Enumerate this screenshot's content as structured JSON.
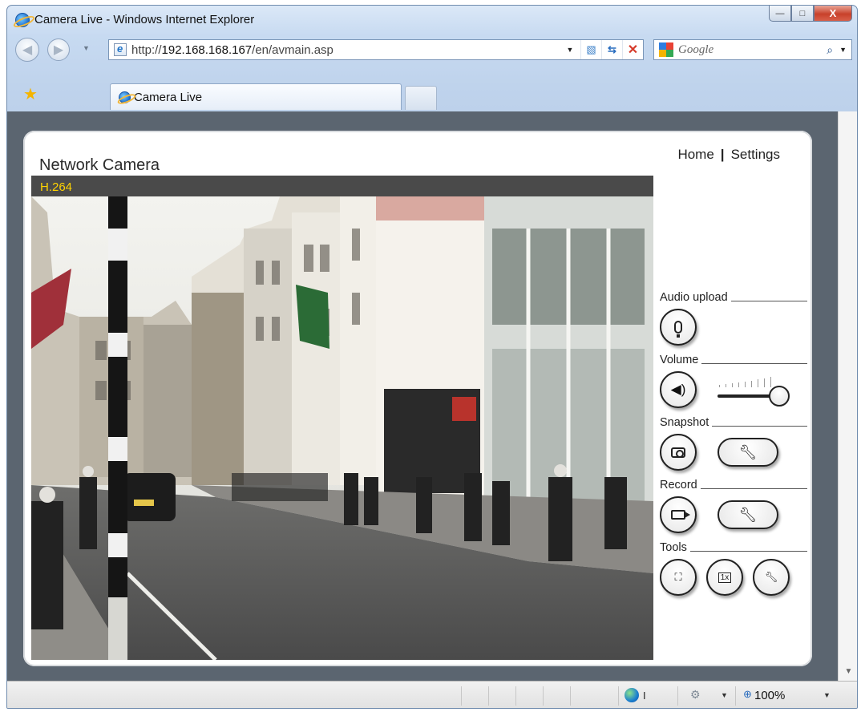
{
  "window": {
    "title": "Camera Live - Windows Internet Explorer",
    "minimize": "—",
    "maximize": "□",
    "close": "X"
  },
  "navbar": {
    "back": "◀",
    "forward": "▶",
    "url_prefix": "http://",
    "url_host": "192.168.168.167",
    "url_path": "/en/avmain.asp",
    "search_placeholder": "Google"
  },
  "tabs": [
    {
      "label": "Camera Live"
    }
  ],
  "page": {
    "title": "Network Camera",
    "nav": {
      "home": "Home",
      "separator": "|",
      "settings": "Settings"
    },
    "codec": "H.264"
  },
  "controls": {
    "audio_upload": "Audio upload",
    "volume": "Volume",
    "snapshot": "Snapshot",
    "record": "Record",
    "tools": "Tools",
    "volume_level": 1.0
  },
  "statusbar": {
    "zone": "I",
    "zoom": "100%"
  },
  "icons": {
    "back": "back-arrow-icon",
    "forward": "forward-arrow-icon",
    "favorites": "star-icon",
    "mic": "microphone-icon",
    "speaker": "speaker-icon",
    "snapshot": "camera-icon",
    "record": "video-camera-icon",
    "wrench": "wrench-icon",
    "fullscreen": "fullscreen-icon",
    "actual_size": "actual-size-icon"
  }
}
